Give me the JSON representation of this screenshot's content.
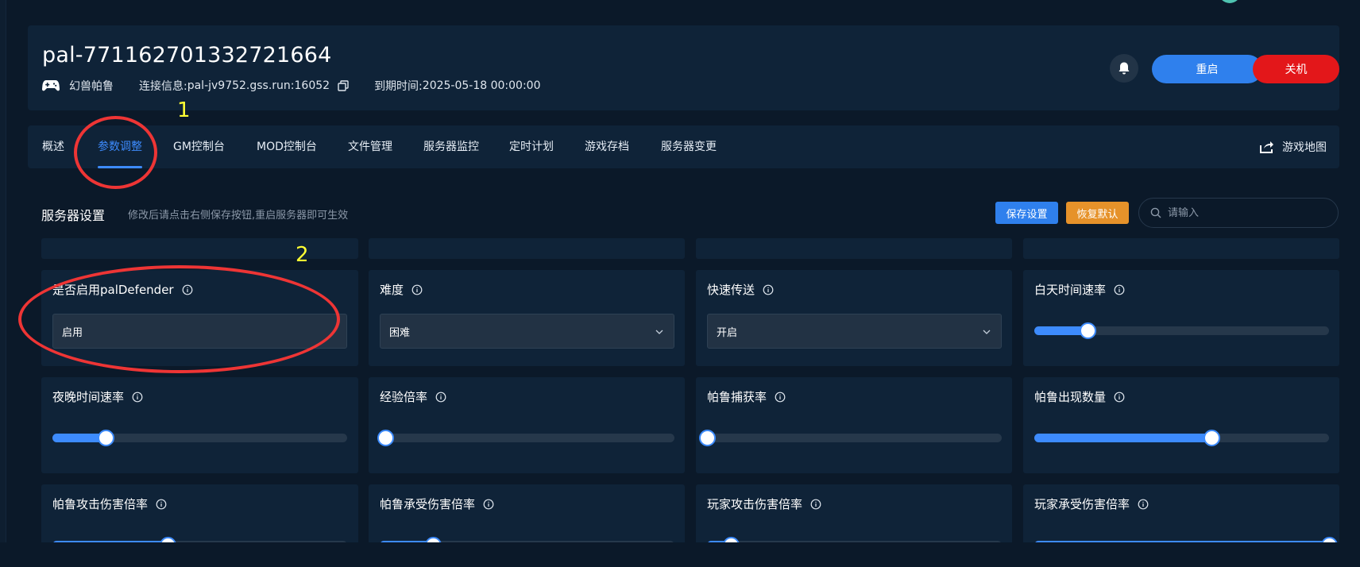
{
  "header": {
    "server_name": "pal-771162701332721664",
    "game_name": "幻兽帕鲁",
    "connection_label": "连接信息:",
    "connection_value": "pal-jv9752.gss.run:16052",
    "expiry_label": "到期时间:",
    "expiry_value": "2025-05-18 00:00:00",
    "restart_label": "重启",
    "shutdown_label": "关机"
  },
  "tabs": [
    {
      "label": "概述",
      "active": false
    },
    {
      "label": "参数调整",
      "active": true
    },
    {
      "label": "GM控制台",
      "active": false
    },
    {
      "label": "MOD控制台",
      "active": false
    },
    {
      "label": "文件管理",
      "active": false
    },
    {
      "label": "服务器监控",
      "active": false
    },
    {
      "label": "定时计划",
      "active": false
    },
    {
      "label": "游戏存档",
      "active": false
    },
    {
      "label": "服务器变更",
      "active": false
    }
  ],
  "map_link_label": "游戏地图",
  "settings": {
    "title": "服务器设置",
    "hint": "修改后请点击右侧保存按钮,重启服务器即可生效",
    "save_label": "保存设置",
    "reset_label": "恢复默认",
    "search_placeholder": "请输入"
  },
  "cards_row1": [
    {
      "label": "是否启用palDefender",
      "type": "select",
      "value": "启用",
      "dropdown": false
    },
    {
      "label": "难度",
      "type": "select",
      "value": "困难",
      "dropdown": true
    },
    {
      "label": "快速传送",
      "type": "select",
      "value": "开启",
      "dropdown": true
    },
    {
      "label": "白天时间速率",
      "type": "slider",
      "level": 0.18
    }
  ],
  "cards_row2": [
    {
      "label": "夜晚时间速率",
      "type": "slider",
      "level": 0.18
    },
    {
      "label": "经验倍率",
      "type": "slider",
      "level": 0.02
    },
    {
      "label": "帕鲁捕获率",
      "type": "slider",
      "level": 0.0
    },
    {
      "label": "帕鲁出现数量",
      "type": "slider",
      "level": 0.6
    }
  ],
  "cards_row3": [
    {
      "label": "帕鲁攻击伤害倍率",
      "type": "slider",
      "level": 0.39
    },
    {
      "label": "帕鲁承受伤害倍率",
      "type": "slider",
      "level": 0.18
    },
    {
      "label": "玩家攻击伤害倍率",
      "type": "slider",
      "level": 0.08
    },
    {
      "label": "玩家承受伤害倍率",
      "type": "slider",
      "level": 1.0
    }
  ],
  "annotations": [
    "1",
    "2"
  ],
  "colors": {
    "accent": "#2f80ed",
    "danger": "#e3171a",
    "warning": "#e6922a",
    "annotation_red": "#ee3535",
    "annotation_yellow": "#ffff33"
  }
}
